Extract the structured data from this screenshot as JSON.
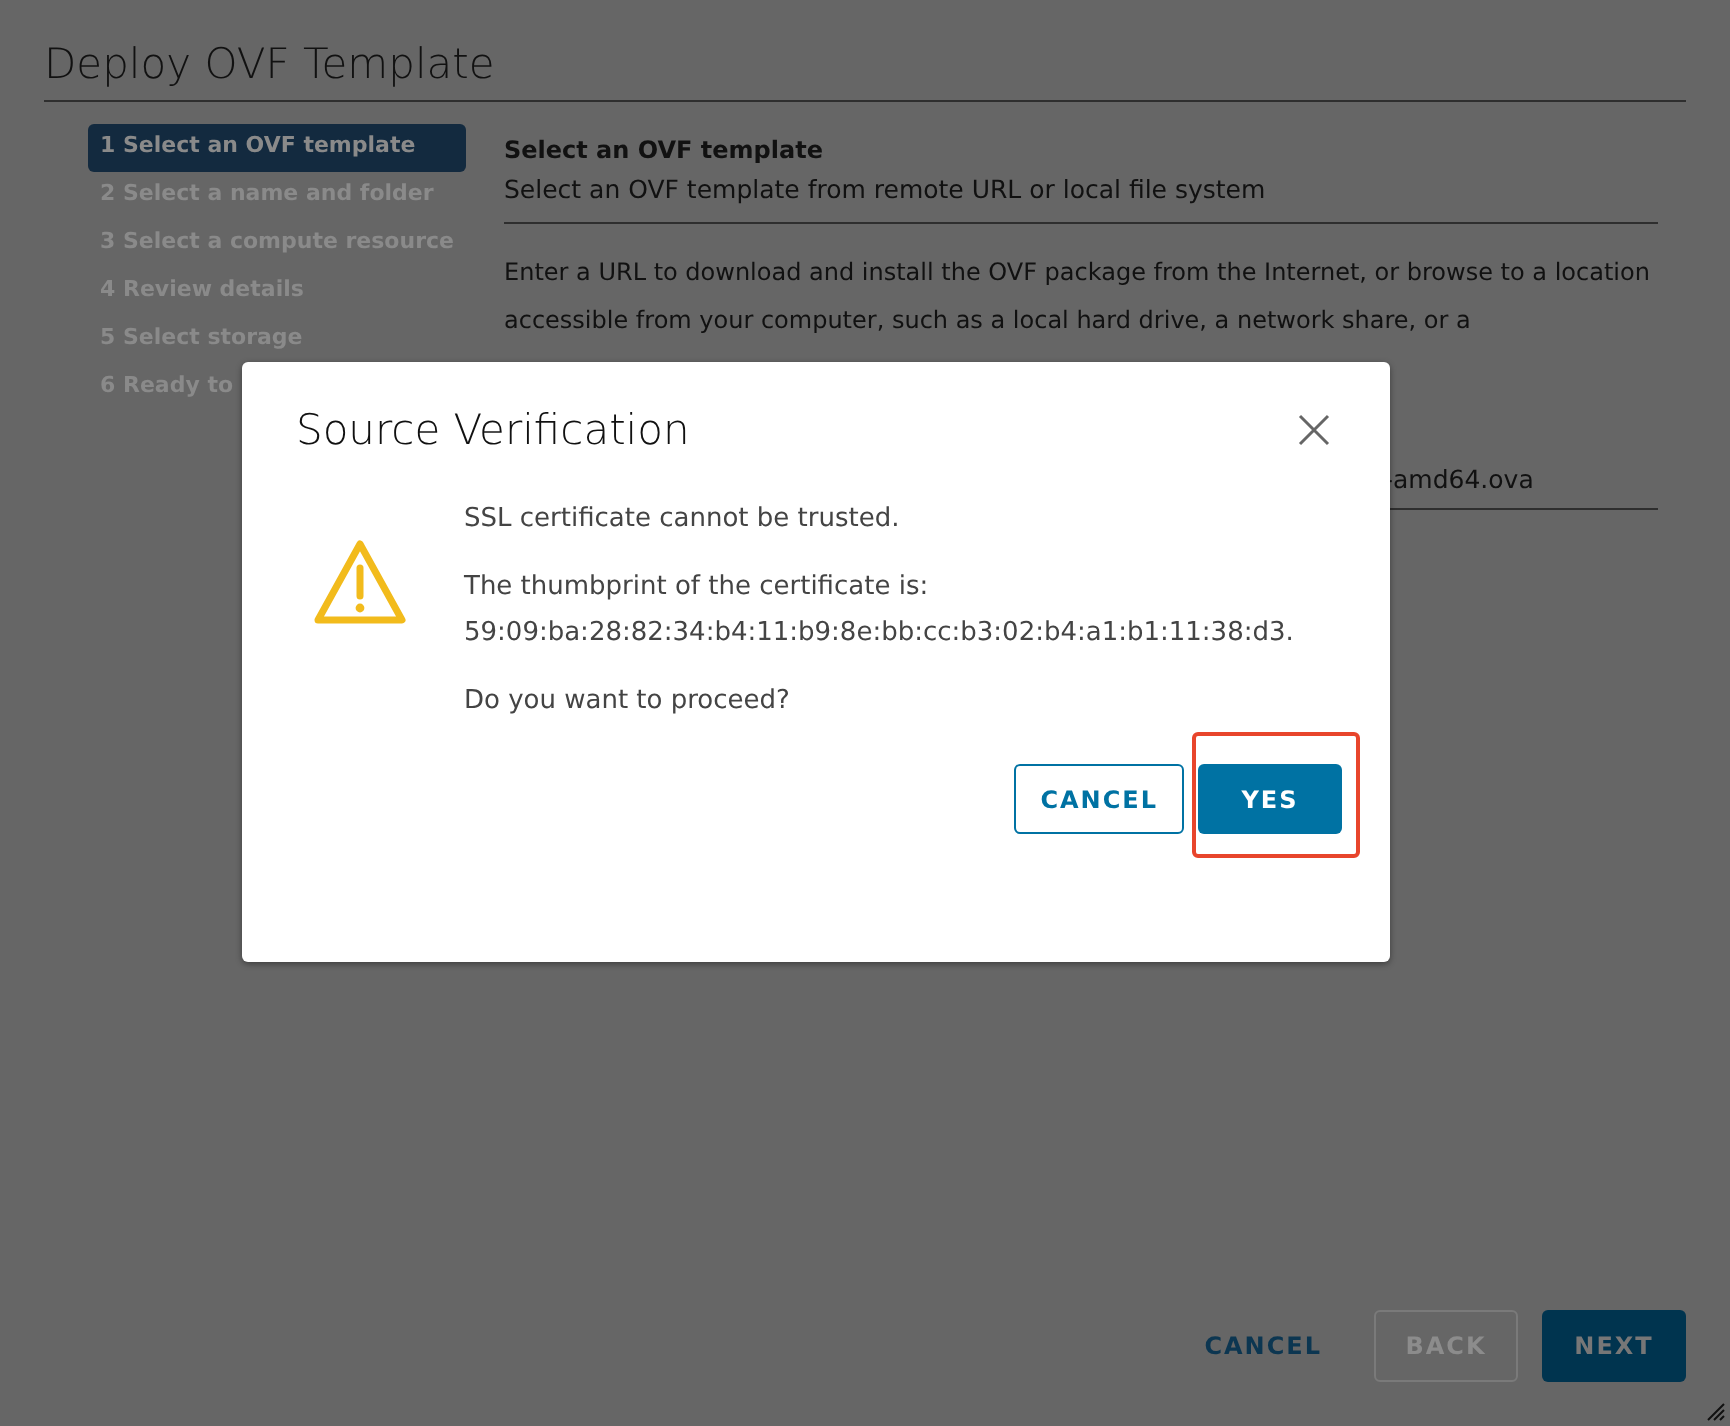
{
  "wizard": {
    "title": "Deploy OVF Template",
    "steps": [
      {
        "label": "1 Select an OVF template",
        "selected": true
      },
      {
        "label": "2 Select a name and folder",
        "selected": false
      },
      {
        "label": "3 Select a compute resource",
        "selected": false
      },
      {
        "label": "4 Review details",
        "selected": false
      },
      {
        "label": "5 Select storage",
        "selected": false
      },
      {
        "label": "6 Ready to",
        "selected": false
      }
    ],
    "content": {
      "heading": "Select an OVF template",
      "subheading": "Select an OVF template from remote URL or local file system",
      "description": "Enter a URL to download and install the OVF package from the Internet, or browse to a location accessible from your computer, such as a local hard drive, a network share, or a",
      "url_field": {
        "value": "-amd64.ova"
      }
    },
    "footer_buttons": [
      {
        "label": "CANCEL",
        "kind": "link",
        "disabled": false
      },
      {
        "label": "BACK",
        "kind": "outline",
        "disabled": true
      },
      {
        "label": "NEXT",
        "kind": "primary",
        "disabled": false
      }
    ]
  },
  "dialog": {
    "title": "Source Verification",
    "paragraphs": [
      [
        "SSL certificate cannot be trusted."
      ],
      [
        "The thumbprint of the certificate is:",
        "59:09:ba:28:82:34:b4:11:b9:8e:bb:cc:b3:02:b4:a1:b1:11:38:d3."
      ],
      [
        "Do you want to proceed?"
      ]
    ],
    "buttons": [
      {
        "label": "CANCEL",
        "kind": "outline",
        "highlighted": false
      },
      {
        "label": "YES",
        "kind": "primary",
        "highlighted": true
      }
    ]
  }
}
